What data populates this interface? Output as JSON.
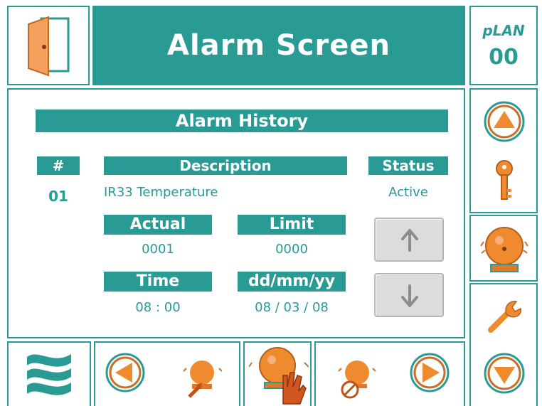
{
  "header": {
    "title": "Alarm Screen",
    "plan_label": "pLAN",
    "plan_value": "00"
  },
  "alarm_history": {
    "title": "Alarm History",
    "columns": {
      "number": "#",
      "description": "Description",
      "status": "Status"
    },
    "entry": {
      "number": "01",
      "description": "IR33 Temperature",
      "status": "Active",
      "actual_label": "Actual",
      "actual_value": "0001",
      "limit_label": "Limit",
      "limit_value": "0000",
      "time_label": "Time",
      "time_value": "08 : 00",
      "date_label": "dd/mm/yy",
      "date_value": "08 / 03 / 08"
    }
  },
  "icons": {
    "door": "door-icon",
    "up": "arrow-up-icon",
    "down": "arrow-down-icon",
    "key": "key-icon",
    "bell": "alarm-bell-icon",
    "wrench": "wrench-icon",
    "logo": "waves-logo-icon",
    "prev": "arrow-left-circle-icon",
    "next": "arrow-right-circle-icon",
    "hand": "alarm-hand-reset-icon",
    "mute": "alarm-mute-icon",
    "alarm_arrow": "alarm-arrow-icon"
  },
  "colors": {
    "teal": "#2a9a94",
    "orange": "#f08a2e"
  }
}
